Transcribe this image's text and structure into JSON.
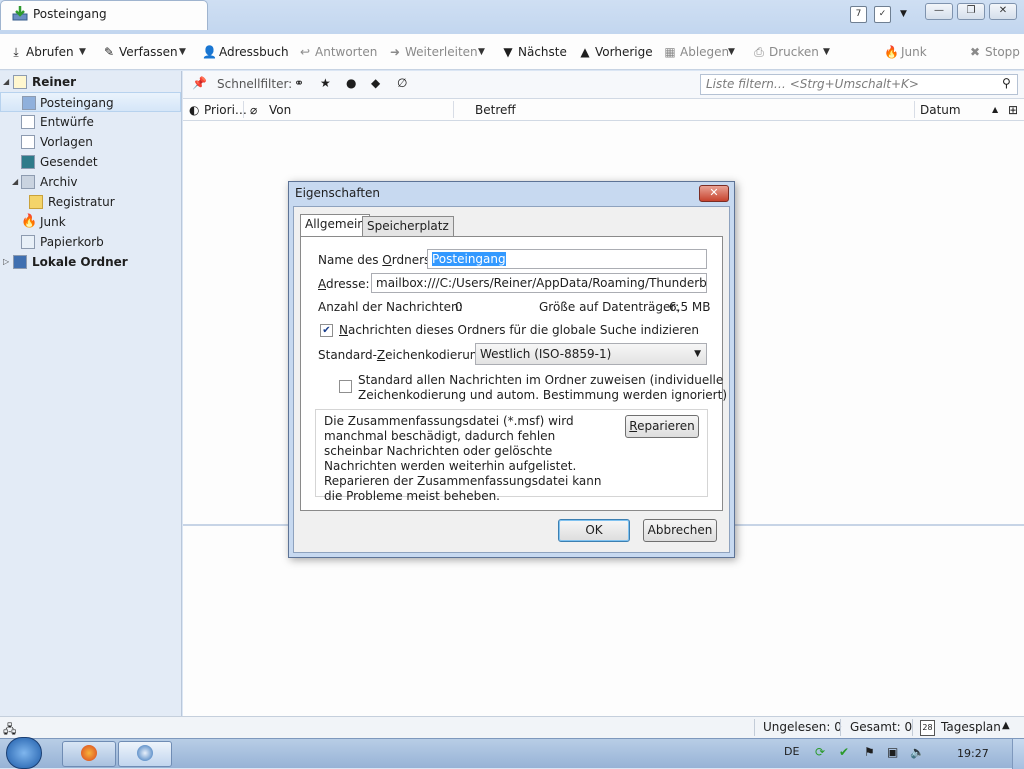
{
  "window": {
    "tab_title": "Posteingang"
  },
  "toolbar": {
    "abrufen": "Abrufen",
    "verfassen": "Verfassen",
    "adressbuch": "Adressbuch",
    "antworten": "Antworten",
    "weiterleiten": "Weiterleiten",
    "naechste": "Nächste",
    "vorherige": "Vorherige",
    "ablegen": "Ablegen",
    "drucken": "Drucken",
    "junk": "Junk",
    "stopp": "Stopp"
  },
  "sidebar": {
    "account": "Reiner",
    "folders": [
      "Posteingang",
      "Entwürfe",
      "Vorlagen",
      "Gesendet",
      "Archiv",
      "Registratur",
      "Junk",
      "Papierkorb"
    ],
    "local": "Lokale Ordner"
  },
  "quickfilter": {
    "label": "Schnellfilter:",
    "placeholder": "Liste filtern… <Strg+Umschalt+K>"
  },
  "columns": {
    "priority": "Priori…",
    "from": "Von",
    "subject": "Betreff",
    "date": "Datum"
  },
  "dialog": {
    "title": "Eigenschaften",
    "tabs": [
      "Allgemein",
      "Speicherplatz"
    ],
    "name_label_pre": "Name des ",
    "name_label_u": "O",
    "name_label_post": "rdners:",
    "name_value": "Posteingang",
    "address_label_u": "A",
    "address_label_post": "dresse:",
    "address_value": "mailbox:///C:/Users/Reiner/AppData/Roaming/Thunderbird/P",
    "count_label": "Anzahl der Nachrichten:",
    "count_value": "0",
    "size_label": "Größe auf Datenträger:",
    "size_value": "6,5 MB",
    "index_u": "N",
    "index_label": "achrichten dieses Ordners für die globale Suche indizieren",
    "encoding_label_pre": "Standard-",
    "encoding_label_u": "Z",
    "encoding_label_post": "eichenkodierung",
    "encoding_value": "Westlich (ISO-8859-1)",
    "apply_line1": "Standard allen Nachrichten im Ordner zuweisen (individuelle",
    "apply_line2": "Zeichenkodierung und autom. Bestimmung werden ignoriert)",
    "repair_text": "Die Zusammenfassungsdatei (*.msf) wird manchmal beschädigt, dadurch fehlen scheinbar Nachrichten oder gelöschte Nachrichten werden weiterhin aufgelistet. Reparieren der Zusammenfassungsdatei kann die Probleme meist beheben.",
    "repair_button": "Reparieren",
    "ok": "OK",
    "cancel": "Abbrechen"
  },
  "statusbar": {
    "unread": "Ungelesen: 0",
    "total": "Gesamt: 0",
    "calendar": "Tagesplan",
    "calendar_day": "28"
  },
  "taskbar": {
    "lang": "DE",
    "time": "19:27"
  },
  "colors": {
    "accent": "#2f6fb8",
    "selection": "#3399ff",
    "close": "#c7432e"
  }
}
